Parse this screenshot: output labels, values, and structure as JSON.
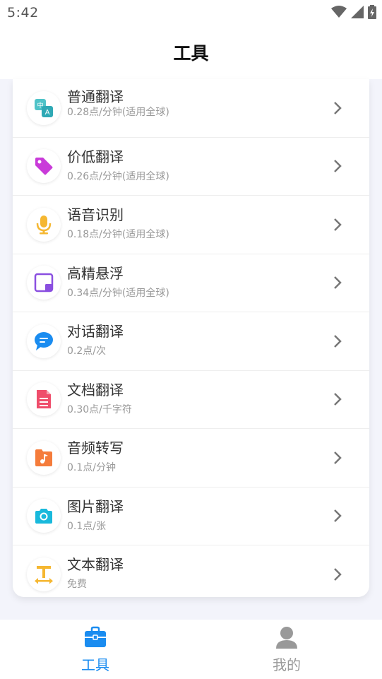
{
  "status": {
    "time": "5:42"
  },
  "header": {
    "title": "工具"
  },
  "tools": [
    {
      "title": "普通翻译",
      "subtitle": "0.28点/分钟(适用全球)",
      "icon": "translate-icon"
    },
    {
      "title": "价低翻译",
      "subtitle": "0.26点/分钟(适用全球)",
      "icon": "price-tag-icon"
    },
    {
      "title": "语音识别",
      "subtitle": "0.18点/分钟(适用全球)",
      "icon": "microphone-icon"
    },
    {
      "title": "高精悬浮",
      "subtitle": "0.34点/分钟(适用全球)",
      "icon": "floating-window-icon"
    },
    {
      "title": "对话翻译",
      "subtitle": "0.2点/次",
      "icon": "chat-bubble-icon"
    },
    {
      "title": "文档翻译",
      "subtitle": "0.30点/千字符",
      "icon": "document-icon"
    },
    {
      "title": "音频转写",
      "subtitle": "0.1点/分钟",
      "icon": "audio-file-icon"
    },
    {
      "title": "图片翻译",
      "subtitle": "0.1点/张",
      "icon": "camera-icon"
    },
    {
      "title": "文本翻译",
      "subtitle": "免费",
      "icon": "text-icon"
    }
  ],
  "tabbar": {
    "tools": {
      "label": "工具",
      "icon": "toolbox-icon",
      "active": true,
      "color": "#1a8cf0"
    },
    "mine": {
      "label": "我的",
      "icon": "user-icon",
      "active": false,
      "color": "#999999"
    }
  },
  "colors": {
    "accent": "#1a8cf0",
    "background": "#f3f4fb"
  }
}
